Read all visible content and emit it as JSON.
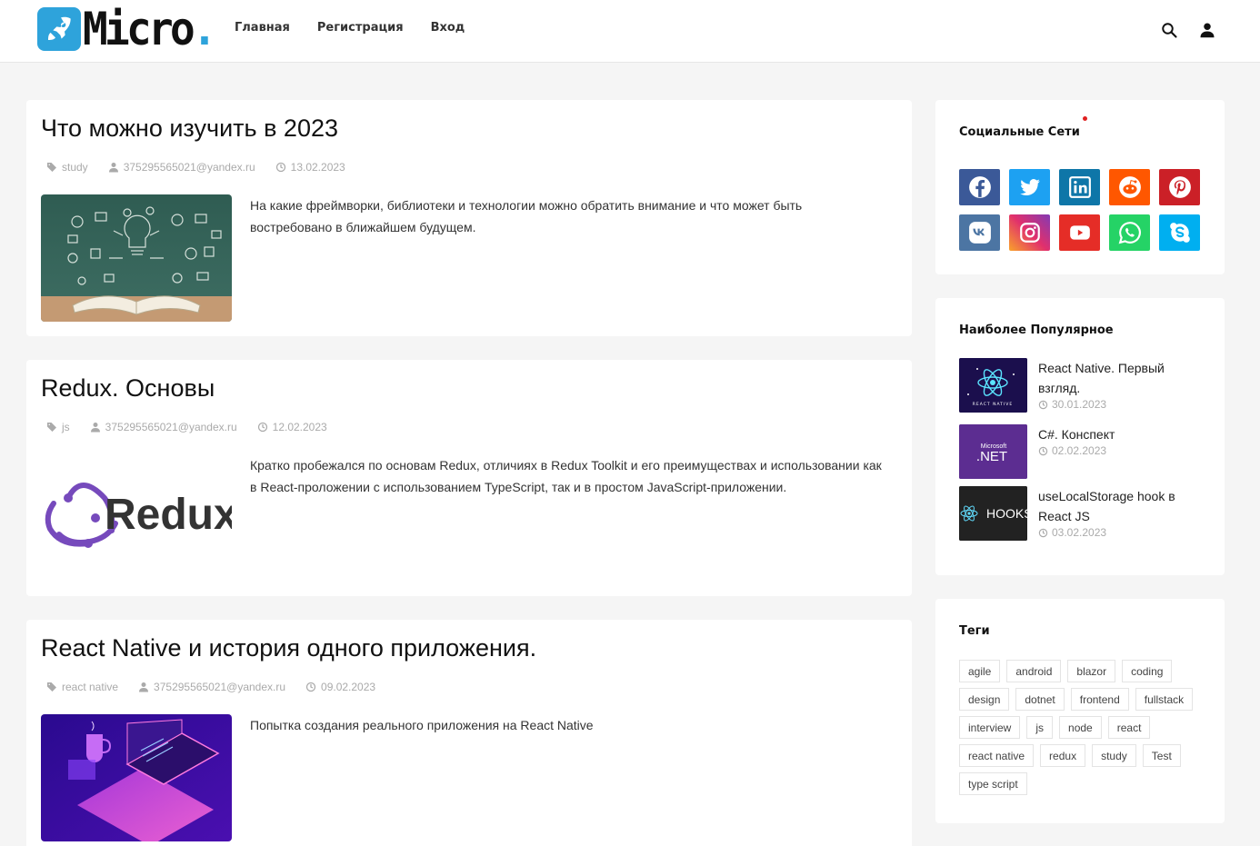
{
  "header": {
    "logo_text": "Micro",
    "logo_dot": ".",
    "nav": [
      "Главная",
      "Регистрация",
      "Вход"
    ]
  },
  "posts": [
    {
      "title": "Что можно изучить в 2023",
      "tag": "study",
      "author": "375295565021@yandex.ru",
      "date": "13.02.2023",
      "excerpt": "На какие фреймворки, библиотеки и технологии можно обратить внимание и что может быть востребовано в ближайшем будущем."
    },
    {
      "title": "Redux. Основы",
      "tag": "js",
      "author": "375295565021@yandex.ru",
      "date": "12.02.2023",
      "thumb_text": "Redux",
      "excerpt": "Кратко пробежался по основам Redux, отличиях в Redux Toolkit и его преимуществах и использовании как в React-проложении с использованием TypeScript, так и в простом JavaScript-приложении."
    },
    {
      "title": "React Native и история одного приложения.",
      "tag": "react native",
      "author": "375295565021@yandex.ru",
      "date": "09.02.2023",
      "excerpt": "Попытка создания реального приложения на React Native"
    }
  ],
  "sidebar": {
    "social_title": "Социальные Сети",
    "social": [
      {
        "name": "facebook",
        "color": "#3b5998"
      },
      {
        "name": "twitter",
        "color": "#1da1f2"
      },
      {
        "name": "linkedin",
        "color": "#0e76a8"
      },
      {
        "name": "reddit",
        "color": "#ff5700"
      },
      {
        "name": "pinterest",
        "color": "#cb2027"
      },
      {
        "name": "vk",
        "color": "#4c75a3"
      },
      {
        "name": "instagram",
        "color": "#e1306c"
      },
      {
        "name": "youtube",
        "color": "#e52d27"
      },
      {
        "name": "whatsapp",
        "color": "#25d366"
      },
      {
        "name": "skype",
        "color": "#00aff0"
      }
    ],
    "popular_title": "Наиболее Популярное",
    "popular": [
      {
        "title": "React Native. Первый взгляд.",
        "date": "30.01.2023",
        "thumb_text": "REACT NATIVE"
      },
      {
        "title": "C#. Конспект",
        "date": "02.02.2023",
        "thumb_small": "Microsoft",
        "thumb_text": ".NET"
      },
      {
        "title": "useLocalStorage hook в React JS",
        "date": "03.02.2023",
        "thumb_text": "HOOKS"
      }
    ],
    "tags_title": "Теги",
    "tags": [
      "agile",
      "android",
      "blazor",
      "coding",
      "design",
      "dotnet",
      "frontend",
      "fullstack",
      "interview",
      "js",
      "node",
      "react",
      "react native",
      "redux",
      "study",
      "Test",
      "type script"
    ]
  }
}
